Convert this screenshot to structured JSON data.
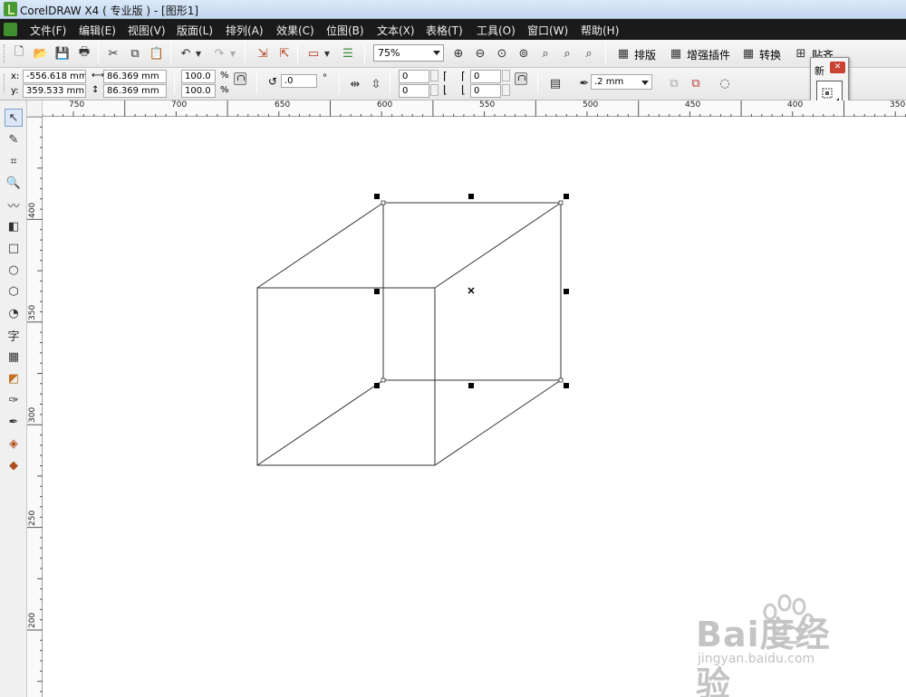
{
  "window": {
    "title": "CorelDRAW X4 ( 专业版 ) - [图形1]"
  },
  "menu": [
    "文件(F)",
    "编辑(E)",
    "视图(V)",
    "版面(L)",
    "排列(A)",
    "效果(C)",
    "位图(B)",
    "文本(X)",
    "表格(T)",
    "工具(O)",
    "窗口(W)",
    "帮助(H)"
  ],
  "toolbar": {
    "zoom": "75%",
    "layout_label": "排版",
    "plugin_label": "增强插件",
    "convert_label": "转换",
    "snap_label": "贴齐"
  },
  "properties": {
    "x_label": "x:",
    "y_label": "y:",
    "x_value": "-556.618 mm",
    "y_value": "359.533 mm",
    "width": "86.369 mm",
    "height": "86.369 mm",
    "scale_x": "100.0",
    "scale_y": "100.0",
    "percent_x": "%",
    "percent_y": "%",
    "rotation": ".0",
    "degree": "°",
    "corner_tl": "0",
    "corner_bl": "0",
    "corner_tr": "0",
    "corner_br": "0",
    "outline_width": ".2 mm"
  },
  "docker": {
    "title": "新"
  },
  "ruler": {
    "h": [
      "750",
      "700",
      "650",
      "600",
      "550",
      "500",
      "450",
      "400",
      "350"
    ],
    "v": [
      "400",
      "350",
      "300",
      "250",
      "200"
    ]
  },
  "watermark": {
    "main": "Bai度经验",
    "sub": "jingyan.baidu.com"
  },
  "colors": {
    "menubar": "#1a1a1a",
    "selection_handle": "#000000"
  }
}
